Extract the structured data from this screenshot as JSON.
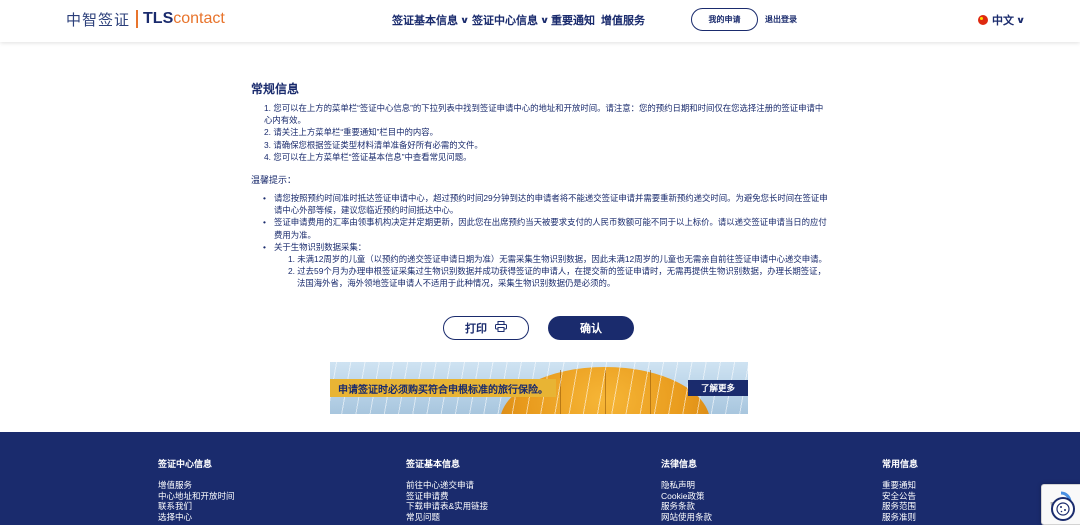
{
  "header": {
    "logo_cn": "中智签证",
    "logo_tls": "TLS",
    "logo_contact": "contact",
    "nav": [
      {
        "label": "签证基本信息",
        "has_dropdown": true
      },
      {
        "label": "签证中心信息",
        "has_dropdown": true
      },
      {
        "label": "重要通知",
        "has_dropdown": false
      },
      {
        "label": "增值服务",
        "has_dropdown": false
      }
    ],
    "my_application": "我的申请",
    "logout": "退出登录",
    "language": "中文"
  },
  "main": {
    "title": "常规信息",
    "list": [
      {
        "num": "1.",
        "text": "您可以在上方的菜单栏“签证中心信息”的下拉列表中找到签证申请中心的地址和开放时间。请注意：您的预约日期和时间仅在您选择注册的签证申请中心内有效。"
      },
      {
        "num": "2.",
        "text": "请关注上方菜单栏“重要通知”栏目中的内容。"
      },
      {
        "num": "3.",
        "text": "请确保您根据签证类型材料清单准备好所有必需的文件。"
      },
      {
        "num": "4.",
        "text": "您可以在上方菜单栏“签证基本信息”中查看常见问题。"
      }
    ],
    "tips_title": "温馨提示：",
    "bullets": [
      "请您按照预约时间准时抵达签证申请中心，超过预约时间29分钟到达的申请者将不能递交签证申请并需要重新预约递交时间。为避免您长时间在签证申请中心外部等候，建议您临近预约时间抵达中心。",
      "签证申请费用的汇率由领事机构决定并定期更新，因此您在出席预约当天被要求支付的人民币数额可能不同于以上标价。请以递交签证申请当日的应付费用为准。",
      "关于生物识别数据采集："
    ],
    "sub_items": [
      "1. 未满12周岁的儿童（以预约的递交签证申请日期为准）无需采集生物识别数据，因此未满12周岁的儿童也无需亲自前往签证申请中心递交申请。",
      "2. 过去59个月为办理申根签证采集过生物识别数据并成功获得签证的申请人，在提交新的签证申请时，无需再提供生物识别数据，办理长期签证，法国海外省，海外领地签证申请人不适用于此种情况，采集生物识别数据仍是必须的。"
    ],
    "print_label": "打印",
    "confirm_label": "确认"
  },
  "banner": {
    "text": "申请签证时必须购买符合申根标准的旅行保险。",
    "button": "了解更多"
  },
  "footer": {
    "columns": [
      {
        "heading": "签证中心信息",
        "items": [
          "增值服务",
          "中心地址和开放时间",
          "联系我们",
          "选择中心"
        ]
      },
      {
        "heading": "签证基本信息",
        "items": [
          "前往中心递交申请",
          "签证申请费",
          "下载申请表&实用链接",
          "常见问题"
        ]
      },
      {
        "heading": "法律信息",
        "items": [
          "隐私声明",
          "Cookie政策",
          "服务条款",
          "网站使用条款"
        ]
      },
      {
        "heading": "常用信息",
        "items": [
          "重要通知",
          "安全公告",
          "服务范围",
          "服务准则"
        ]
      }
    ]
  },
  "colors": {
    "primary": "#1a2b6d",
    "accent": "#e8742c",
    "banner_yellow": "#e8b434"
  }
}
